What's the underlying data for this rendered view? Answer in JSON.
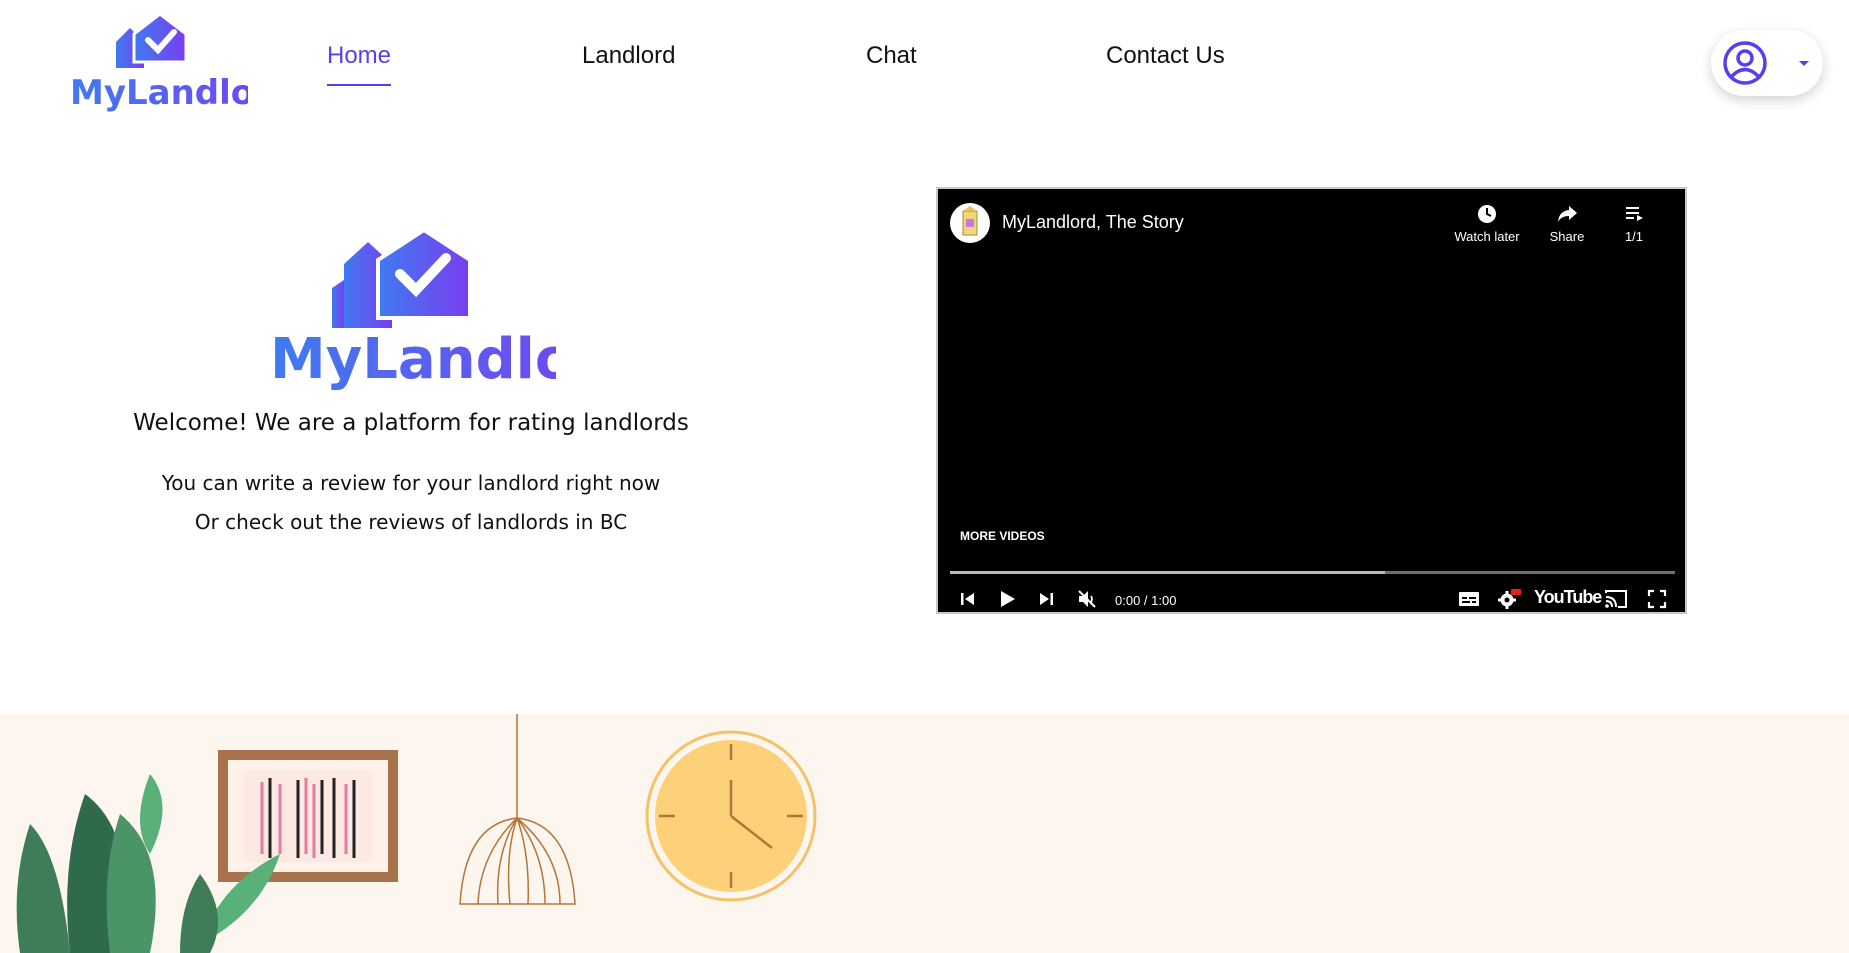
{
  "brand": {
    "name": "MyLandlord",
    "primary": "#5a3df0",
    "logo_gradient": [
      "#3f7bf0",
      "#7a3df0"
    ]
  },
  "nav": {
    "items": [
      {
        "label": "Home",
        "active": true
      },
      {
        "label": "Landlord",
        "active": false
      },
      {
        "label": "Chat",
        "active": false
      },
      {
        "label": "Contact Us",
        "active": false
      }
    ]
  },
  "user_menu": {
    "icon": "user-circle-icon",
    "caret": "caret-down-icon"
  },
  "hero": {
    "welcome": "Welcome! We are a platform for rating landlords",
    "line1": "You can write a review for your landlord right now",
    "line2": "Or check out the reviews of landlords in BC"
  },
  "video": {
    "title": "MyLandlord, The Story",
    "watch_later": "Watch later",
    "share": "Share",
    "playlist": "1/1",
    "more_videos": "MORE VIDEOS",
    "time": "0:00 / 1:00",
    "progress_fraction": 0.6,
    "logo_text": "YouTube"
  }
}
